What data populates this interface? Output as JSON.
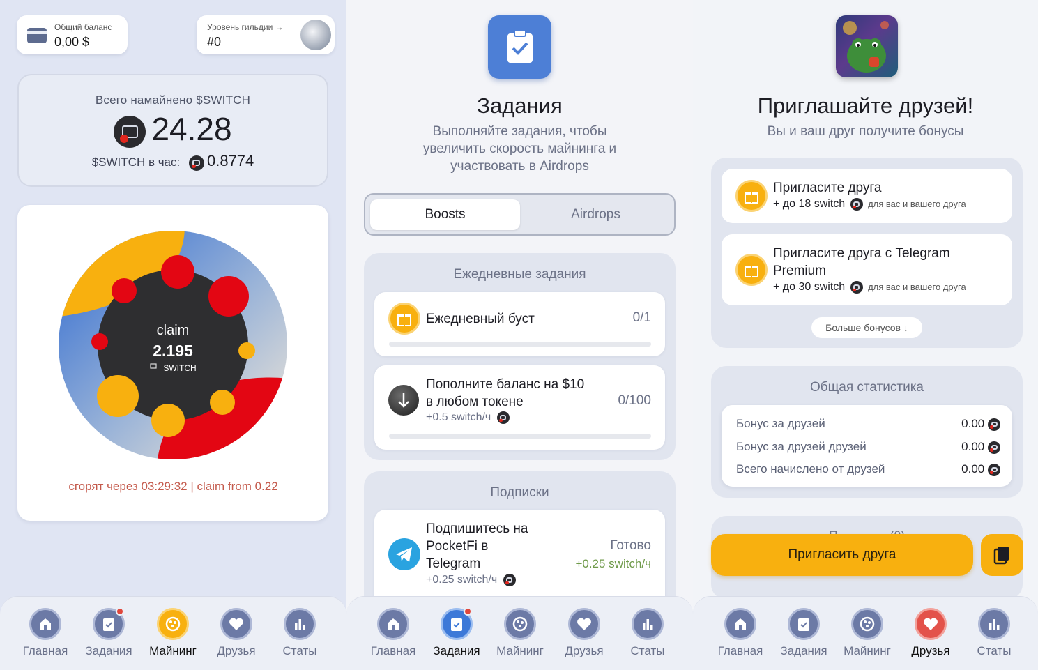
{
  "mining": {
    "balance": {
      "label": "Общий баланс",
      "value": "0,00 $"
    },
    "guild": {
      "label": "Уровень гильдии →",
      "value": "#0"
    },
    "mined": {
      "label": "Всего намайнено $SWITCH",
      "value": "24.28",
      "rate_label": "$SWITCH в час:",
      "rate_value": "0.8774"
    },
    "claim": {
      "label": "claim",
      "amount": "2.195",
      "token": "SWITCH"
    },
    "expires": "сгорят через 03:29:32 | claim from 0.22"
  },
  "tasks": {
    "title": "Задания",
    "subtitle_lines": [
      "Выполняйте задания, чтобы",
      "увеличить скорость майнинга и",
      "участвовать в Airdrops"
    ],
    "tabs": [
      "Boosts",
      "Airdrops"
    ],
    "daily": {
      "title": "Ежедневные задания",
      "items": [
        {
          "title": "Ежедневный буст",
          "count": "0/1"
        },
        {
          "title_lines": [
            "Пополните баланс на $10",
            "в любом токене"
          ],
          "reward": "+0.5 switch/ч",
          "count": "0/100"
        }
      ]
    },
    "subs": {
      "title": "Подписки",
      "item": {
        "title_lines": [
          "Подпишитесь на",
          "PocketFi в",
          "Telegram"
        ],
        "reward": "+0.25 switch/ч",
        "status": "Готово",
        "status_reward": "+0.25 switch/ч"
      }
    }
  },
  "friends": {
    "title": "Приглашайте друзей!",
    "subtitle": "Вы и ваш друг получите бонусы",
    "invite1": {
      "title": "Пригласите друга",
      "amount": "+ до 18 switch",
      "note": "для вас и вашего друга"
    },
    "invite2": {
      "title_lines": [
        "Пригласите друга с Telegram",
        "Premium"
      ],
      "amount": "+ до 30 switch",
      "note": "для вас и вашего друга"
    },
    "more_bonuses": "Больше бонусов ↓",
    "stats": {
      "title": "Общая статистика",
      "rows": [
        {
          "label": "Бонус за друзей",
          "value": "0.00"
        },
        {
          "label": "Бонус за друзей друзей",
          "value": "0.00"
        },
        {
          "label": "Всего начислено от друзей",
          "value": "0.00"
        }
      ]
    },
    "hidden_section_partial": "П                (0)",
    "invite_button": "Пригласить друга"
  },
  "nav": [
    "Главная",
    "Задания",
    "Майнинг",
    "Друзья",
    "Статы"
  ],
  "colors": {
    "accent_yellow": "#f8b00f",
    "accent_blue": "#3d79d8",
    "accent_red": "#e3524a",
    "claim_red": "#c45a4c",
    "nav_icon": "#6c7aa6"
  }
}
